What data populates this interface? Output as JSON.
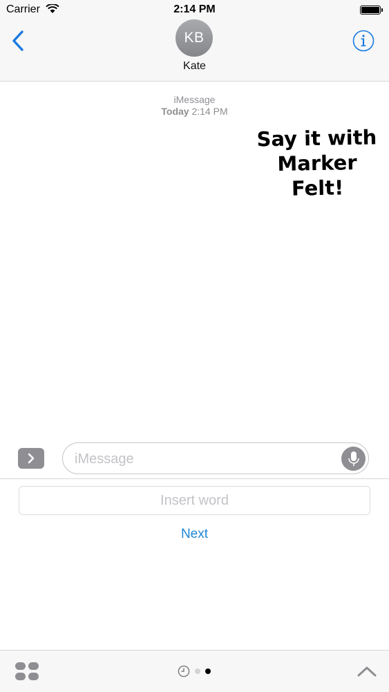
{
  "status_bar": {
    "carrier": "Carrier",
    "time": "2:14 PM"
  },
  "nav": {
    "avatar_initials": "KB",
    "contact_name": "Kate"
  },
  "conversation": {
    "service": "iMessage",
    "day": "Today",
    "time": "2:14 PM",
    "sticker_lines": [
      "Say it with",
      "Marker",
      "Felt!"
    ]
  },
  "compose": {
    "placeholder": "iMessage"
  },
  "app_panel": {
    "insert_placeholder": "Insert word",
    "next_label": "Next"
  },
  "colors": {
    "accent": "#1f86d4",
    "avatar": "#96979b"
  },
  "icons": [
    "wifi-icon",
    "battery-icon",
    "back-icon",
    "info-icon",
    "chevron-right-icon",
    "mic-icon",
    "apps-icon",
    "recents-icon",
    "chevron-up-icon"
  ]
}
